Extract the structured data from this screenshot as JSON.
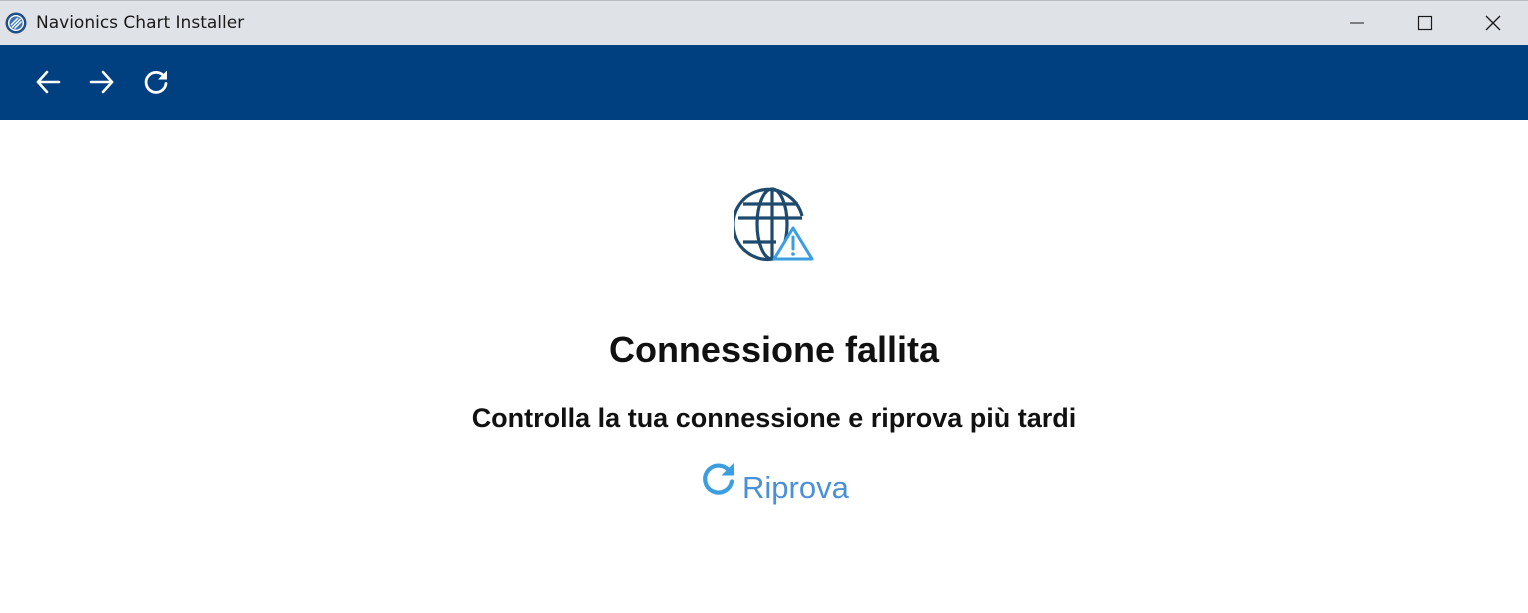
{
  "window": {
    "title": "Navionics Chart Installer"
  },
  "titlebar_controls": {
    "minimize_icon": "minimize-icon",
    "maximize_icon": "maximize-icon",
    "close_icon": "close-icon"
  },
  "toolbar": {
    "back_icon": "arrow-left-icon",
    "forward_icon": "arrow-right-icon",
    "reload_icon": "reload-icon",
    "background_color": "#003f80"
  },
  "error": {
    "icon": "globe-warning-icon",
    "title": "Connessione fallita",
    "message": "Controlla la tua connessione e riprova più tardi",
    "retry_icon": "refresh-icon",
    "retry_label": "Riprova",
    "retry_color": "#4a90d9",
    "icon_color": "#1e4a6e",
    "warning_color": "#3a9ee0"
  }
}
